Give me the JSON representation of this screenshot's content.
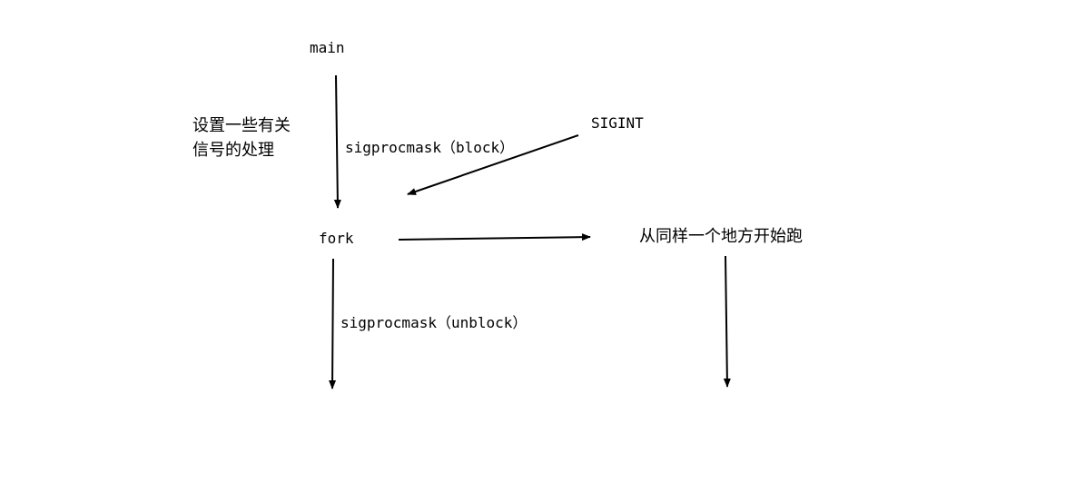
{
  "nodes": {
    "main": "main",
    "fork": "fork",
    "sigint": "SIGINT",
    "child_start": "从同样一个地方开始跑"
  },
  "annotations": {
    "signal_setup_line1": "设置一些有关",
    "signal_setup_line2": "信号的处理",
    "block": "sigprocmask（block）",
    "unblock": "sigprocmask（unblock）"
  },
  "colors": {
    "background": "#ffffff",
    "line": "#000000",
    "text": "#000000"
  }
}
